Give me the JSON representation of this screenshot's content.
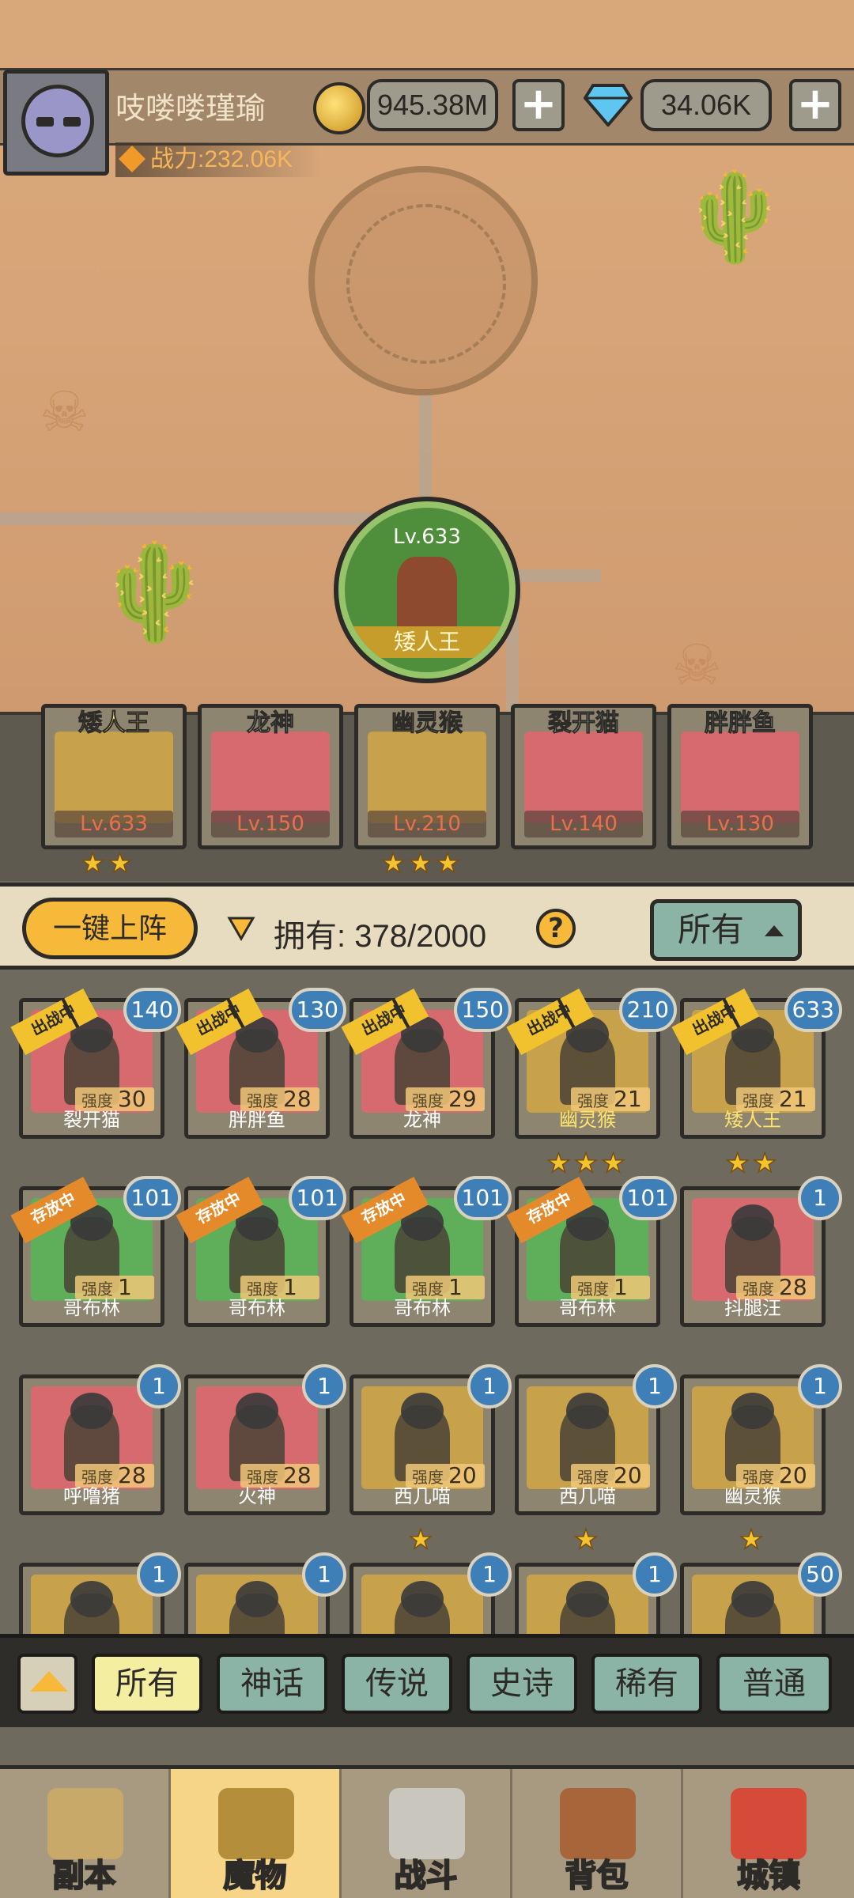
{
  "player": {
    "name": "吱喽喽瑾瑜",
    "power": "战力:232.06K"
  },
  "currency": {
    "gold": "945.38M",
    "gems": "34.06K"
  },
  "boss": {
    "level": "Lv.633",
    "name": "矮人王"
  },
  "team": [
    {
      "name": "矮人王",
      "level": "Lv.633",
      "stars": "★★",
      "color": "#c7a24a"
    },
    {
      "name": "龙神",
      "level": "Lv.150",
      "stars": "",
      "color": "#d76a6e"
    },
    {
      "name": "幽灵猴",
      "level": "Lv.210",
      "stars": "★★★",
      "color": "#c7a24a"
    },
    {
      "name": "裂开猫",
      "level": "Lv.140",
      "stars": "",
      "color": "#d76a6e"
    },
    {
      "name": "胖胖鱼",
      "level": "Lv.130",
      "stars": "",
      "color": "#d76a6e"
    }
  ],
  "inventory_header": {
    "deploy_label": "一键上阵",
    "owned_text": "拥有: 378/2000",
    "help_label": "?",
    "filter_label": "所有"
  },
  "cards": [
    {
      "name": "裂开猫",
      "lv": "140",
      "strength_label": "强度",
      "strength": "30",
      "ribbon": "出战中",
      "ribbon_type": "battle",
      "bg": "#d76a6e",
      "stars": "",
      "gold": false
    },
    {
      "name": "胖胖鱼",
      "lv": "130",
      "strength_label": "强度",
      "strength": "28",
      "ribbon": "出战中",
      "ribbon_type": "battle",
      "bg": "#d76a6e",
      "stars": "",
      "gold": false
    },
    {
      "name": "龙神",
      "lv": "150",
      "strength_label": "强度",
      "strength": "29",
      "ribbon": "出战中",
      "ribbon_type": "battle",
      "bg": "#d76a6e",
      "stars": "",
      "gold": false
    },
    {
      "name": "幽灵猴",
      "lv": "210",
      "strength_label": "强度",
      "strength": "21",
      "ribbon": "出战中",
      "ribbon_type": "battle",
      "bg": "#c7a24a",
      "stars": "★★★",
      "gold": true
    },
    {
      "name": "矮人王",
      "lv": "633",
      "strength_label": "强度",
      "strength": "21",
      "ribbon": "出战中",
      "ribbon_type": "battle",
      "bg": "#c7a24a",
      "stars": "★★",
      "gold": true
    },
    {
      "name": "哥布林",
      "lv": "101",
      "strength_label": "强度",
      "strength": "1",
      "ribbon": "存放中",
      "ribbon_type": "stored",
      "bg": "#5faf5a",
      "stars": "",
      "gold": false
    },
    {
      "name": "哥布林",
      "lv": "101",
      "strength_label": "强度",
      "strength": "1",
      "ribbon": "存放中",
      "ribbon_type": "stored",
      "bg": "#5faf5a",
      "stars": "",
      "gold": false
    },
    {
      "name": "哥布林",
      "lv": "101",
      "strength_label": "强度",
      "strength": "1",
      "ribbon": "存放中",
      "ribbon_type": "stored",
      "bg": "#5faf5a",
      "stars": "",
      "gold": false
    },
    {
      "name": "哥布林",
      "lv": "101",
      "strength_label": "强度",
      "strength": "1",
      "ribbon": "存放中",
      "ribbon_type": "stored",
      "bg": "#5faf5a",
      "stars": "",
      "gold": false
    },
    {
      "name": "抖腿汪",
      "lv": "1",
      "strength_label": "强度",
      "strength": "28",
      "ribbon": "",
      "ribbon_type": "",
      "bg": "#d76a6e",
      "stars": "",
      "gold": false
    },
    {
      "name": "呼噜猪",
      "lv": "1",
      "strength_label": "强度",
      "strength": "28",
      "ribbon": "",
      "ribbon_type": "",
      "bg": "#d76a6e",
      "stars": "",
      "gold": false
    },
    {
      "name": "火神",
      "lv": "1",
      "strength_label": "强度",
      "strength": "28",
      "ribbon": "",
      "ribbon_type": "",
      "bg": "#d76a6e",
      "stars": "",
      "gold": false
    },
    {
      "name": "西几喵",
      "lv": "1",
      "strength_label": "强度",
      "strength": "20",
      "ribbon": "",
      "ribbon_type": "",
      "bg": "#c7a24a",
      "stars": "★",
      "gold": false
    },
    {
      "name": "西几喵",
      "lv": "1",
      "strength_label": "强度",
      "strength": "20",
      "ribbon": "",
      "ribbon_type": "",
      "bg": "#c7a24a",
      "stars": "★",
      "gold": false
    },
    {
      "name": "幽灵猴",
      "lv": "1",
      "strength_label": "强度",
      "strength": "20",
      "ribbon": "",
      "ribbon_type": "",
      "bg": "#c7a24a",
      "stars": "★",
      "gold": false
    },
    {
      "name": "",
      "lv": "1",
      "strength_label": "",
      "strength": "",
      "ribbon": "",
      "ribbon_type": "",
      "bg": "#c7a24a",
      "stars": "",
      "gold": false
    },
    {
      "name": "",
      "lv": "1",
      "strength_label": "",
      "strength": "",
      "ribbon": "",
      "ribbon_type": "",
      "bg": "#c7a24a",
      "stars": "",
      "gold": false
    },
    {
      "name": "",
      "lv": "1",
      "strength_label": "",
      "strength": "",
      "ribbon": "",
      "ribbon_type": "",
      "bg": "#c7a24a",
      "stars": "",
      "gold": false
    },
    {
      "name": "",
      "lv": "1",
      "strength_label": "",
      "strength": "",
      "ribbon": "",
      "ribbon_type": "",
      "bg": "#c7a24a",
      "stars": "",
      "gold": false
    },
    {
      "name": "",
      "lv": "50",
      "strength_label": "",
      "strength": "",
      "ribbon": "",
      "ribbon_type": "",
      "bg": "#c7a24a",
      "stars": "",
      "gold": false
    }
  ],
  "rarity_tabs": [
    "所有",
    "神话",
    "传说",
    "史诗",
    "稀有",
    "普通"
  ],
  "nav": [
    {
      "label": "副本",
      "icon": "map-scroll-icon",
      "color": "#c9a96a"
    },
    {
      "label": "魔物",
      "icon": "monster-helmet-icon",
      "color": "#b58e3c"
    },
    {
      "label": "战斗",
      "icon": "crossed-swords-icon",
      "color": "#c9c6bd"
    },
    {
      "label": "背包",
      "icon": "backpack-icon",
      "color": "#a8653a"
    },
    {
      "label": "城镇",
      "icon": "town-shop-icon",
      "color": "#d64a3a"
    }
  ]
}
